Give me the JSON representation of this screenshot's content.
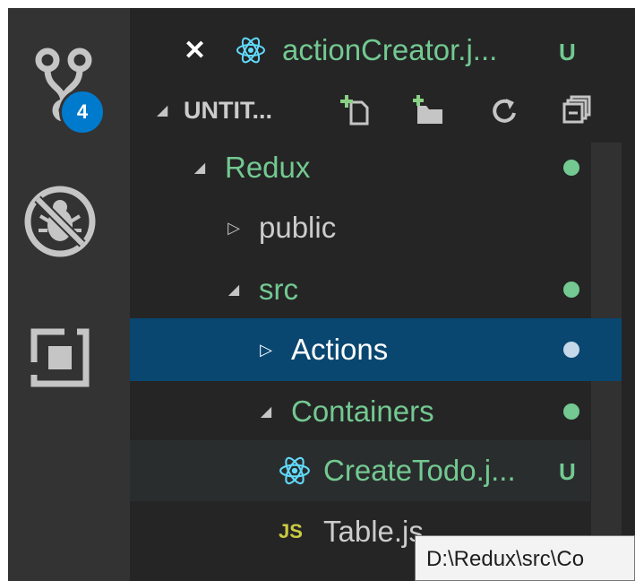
{
  "activity_bar": {
    "items": [
      {
        "icon": "source-control-icon",
        "badge": "4"
      },
      {
        "icon": "debug-disabled-icon"
      },
      {
        "icon": "extensions-icon"
      }
    ]
  },
  "open_editors": {
    "items": [
      {
        "icon": "react-icon",
        "label": "actionCreator.j...",
        "status": "U"
      }
    ]
  },
  "explorer": {
    "section_title": "UNTIT...",
    "actions": [
      "new-file-icon",
      "new-folder-icon",
      "refresh-icon",
      "collapse-all-icon"
    ],
    "tree": [
      {
        "label": "Redux",
        "expanded": true,
        "git": true
      },
      {
        "label": "public",
        "expanded": false,
        "git": false
      },
      {
        "label": "src",
        "expanded": true,
        "git": true
      },
      {
        "label": "Actions",
        "expanded": false,
        "git": true,
        "selected": true
      },
      {
        "label": "Containers",
        "expanded": true,
        "git": true
      },
      {
        "label": "CreateTodo.j...",
        "icon": "react-icon",
        "status": "U"
      },
      {
        "label": "Table.js",
        "icon_text": "JS"
      }
    ]
  },
  "tooltip": {
    "text": "D:\\Redux\\src\\Co"
  },
  "colors": {
    "git_untracked": "#73c991",
    "selection": "#094771",
    "badge": "#007acc",
    "js_icon": "#cbcb41"
  }
}
